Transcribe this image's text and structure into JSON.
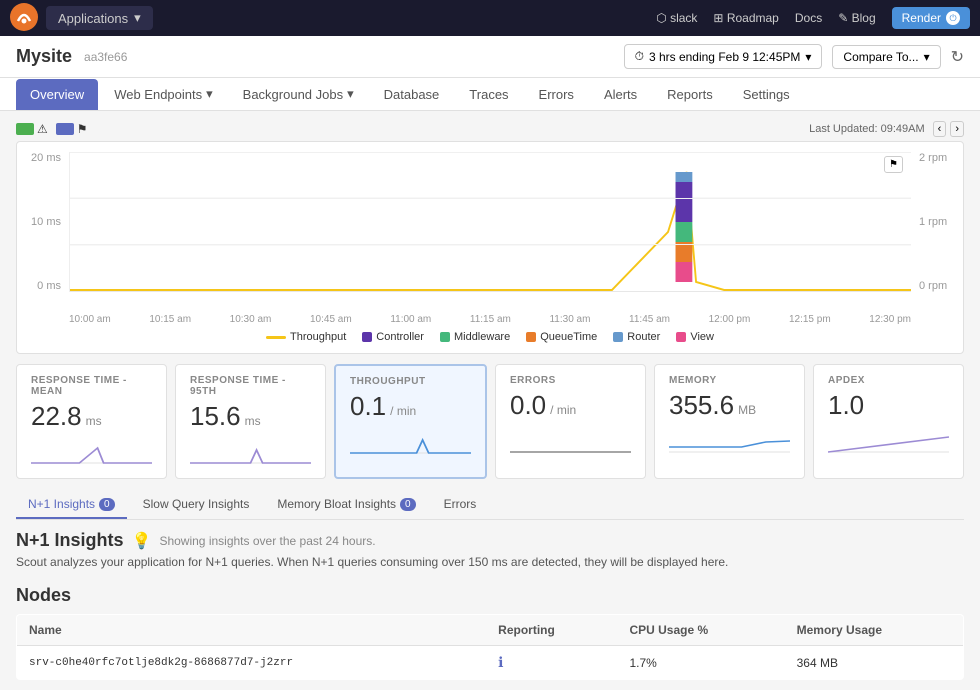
{
  "topNav": {
    "appLabel": "Applications",
    "links": [
      {
        "label": "slack",
        "icon": "slack-icon"
      },
      {
        "label": "Roadmap",
        "icon": "roadmap-icon"
      },
      {
        "label": "Docs",
        "icon": "docs-icon"
      },
      {
        "label": "Blog",
        "icon": "blog-icon"
      }
    ],
    "renderLabel": "Render"
  },
  "subheader": {
    "siteName": "Mysite",
    "siteId": "aa3fe66",
    "timeRange": "3 hrs ending Feb 9  12:45PM",
    "compareTo": "Compare To...",
    "lastUpdated": "Last Updated: 09:49AM"
  },
  "navTabs": {
    "tabs": [
      {
        "label": "Overview",
        "active": true,
        "hasDropdown": false
      },
      {
        "label": "Web Endpoints",
        "active": false,
        "hasDropdown": true
      },
      {
        "label": "Background Jobs",
        "active": false,
        "hasDropdown": true
      },
      {
        "label": "Database",
        "active": false,
        "hasDropdown": false
      },
      {
        "label": "Traces",
        "active": false,
        "hasDropdown": false
      },
      {
        "label": "Errors",
        "active": false,
        "hasDropdown": false
      },
      {
        "label": "Alerts",
        "active": false,
        "hasDropdown": false
      },
      {
        "label": "Reports",
        "active": false,
        "hasDropdown": false
      },
      {
        "label": "Settings",
        "active": false,
        "hasDropdown": false
      }
    ]
  },
  "chart": {
    "yLabelsLeft": [
      "20 ms",
      "10 ms",
      "0 ms"
    ],
    "yLabelsRight": [
      "2 rpm",
      "1 rpm",
      "0 rpm"
    ],
    "xLabels": [
      "10:00 am",
      "10:15 am",
      "10:30 am",
      "10:45 am",
      "11:00 am",
      "11:15 am",
      "11:30 am",
      "11:45 am",
      "12:00 pm",
      "12:15 pm",
      "12:30 pm"
    ],
    "legend": [
      {
        "label": "Throughput",
        "color": "#f5c518",
        "type": "line"
      },
      {
        "label": "Controller",
        "color": "#5c35aa",
        "type": "square"
      },
      {
        "label": "Middleware",
        "color": "#44b87c",
        "type": "square"
      },
      {
        "label": "QueueTime",
        "color": "#e87c2a",
        "type": "square"
      },
      {
        "label": "Router",
        "color": "#6699cc",
        "type": "square"
      },
      {
        "label": "View",
        "color": "#e84c8b",
        "type": "square"
      }
    ]
  },
  "metrics": [
    {
      "label": "RESPONSE TIME - MEAN",
      "value": "22.8",
      "unit": "ms",
      "highlighted": false
    },
    {
      "label": "RESPONSE TIME - 95TH",
      "value": "15.6",
      "unit": "ms",
      "highlighted": false
    },
    {
      "label": "THROUGHPUT",
      "value": "0.1",
      "unit": "/ min",
      "highlighted": true
    },
    {
      "label": "ERRORS",
      "value": "0.0",
      "unit": "/ min",
      "highlighted": false
    },
    {
      "label": "MEMORY",
      "value": "355.6",
      "unit": "MB",
      "highlighted": false
    },
    {
      "label": "APDEX",
      "value": "1.0",
      "unit": "",
      "highlighted": false
    }
  ],
  "insightsTabs": [
    {
      "label": "N+1 Insights",
      "active": true,
      "badge": "0"
    },
    {
      "label": "Slow Query Insights",
      "active": false,
      "badge": null
    },
    {
      "label": "Memory Bloat Insights",
      "active": false,
      "badge": "0"
    },
    {
      "label": "Errors",
      "active": false,
      "badge": null
    }
  ],
  "insights": {
    "title": "N+1 Insights",
    "subtitle": "Showing insights over the past 24 hours.",
    "description": "Scout analyzes your application for N+1 queries. When N+1 queries consuming over 150 ms are detected, they will be displayed here."
  },
  "nodes": {
    "title": "Nodes",
    "columns": [
      "Name",
      "Reporting",
      "CPU Usage %",
      "Memory Usage"
    ],
    "rows": [
      {
        "name": "srv-c0he40rfc7otlje8dk2g-8686877d7-j2zrr",
        "reporting": "info",
        "cpuUsage": "1.7%",
        "memoryUsage": "364 MB"
      }
    ]
  }
}
